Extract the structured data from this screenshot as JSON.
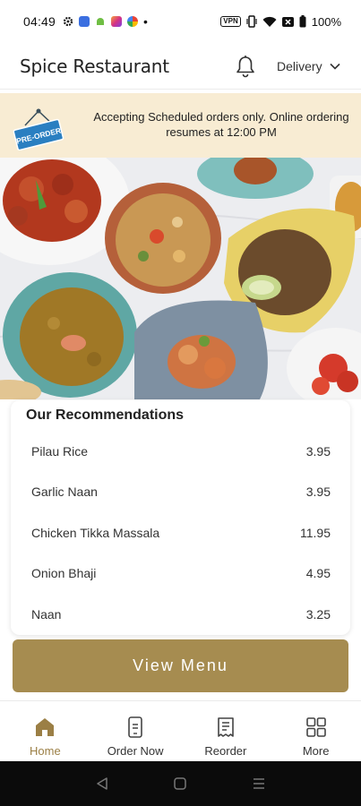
{
  "status_bar": {
    "time": "04:49",
    "dot": "•",
    "vpn": "VPN",
    "battery": "100%",
    "icons": [
      "settings-icon",
      "messenger-icon",
      "android-icon",
      "instagram-icon",
      "photos-icon"
    ]
  },
  "header": {
    "title": "Spice Restaurant",
    "delivery_label": "Delivery"
  },
  "banner": {
    "tag_text": "PRE-ORDER",
    "message": "Accepting Scheduled orders only. Online ordering resumes at 12:00 PM"
  },
  "recommendations": {
    "title": "Our Recommendations",
    "items": [
      {
        "name": "Pilau Rice",
        "price": "3.95"
      },
      {
        "name": "Garlic Naan",
        "price": "3.95"
      },
      {
        "name": "Chicken Tikka Massala",
        "price": "11.95"
      },
      {
        "name": "Onion Bhaji",
        "price": "4.95"
      },
      {
        "name": "Naan",
        "price": "3.25"
      }
    ]
  },
  "view_menu_label": "View Menu",
  "bottom_nav": {
    "items": [
      {
        "label": "Home",
        "icon": "home-icon",
        "active": true
      },
      {
        "label": "Order Now",
        "icon": "order-icon",
        "active": false
      },
      {
        "label": "Reorder",
        "icon": "receipt-icon",
        "active": false
      },
      {
        "label": "More",
        "icon": "grid-icon",
        "active": false
      }
    ]
  },
  "colors": {
    "accent": "#a68c50",
    "banner_bg": "#f8ecd3",
    "active_nav": "#9b7f45"
  }
}
